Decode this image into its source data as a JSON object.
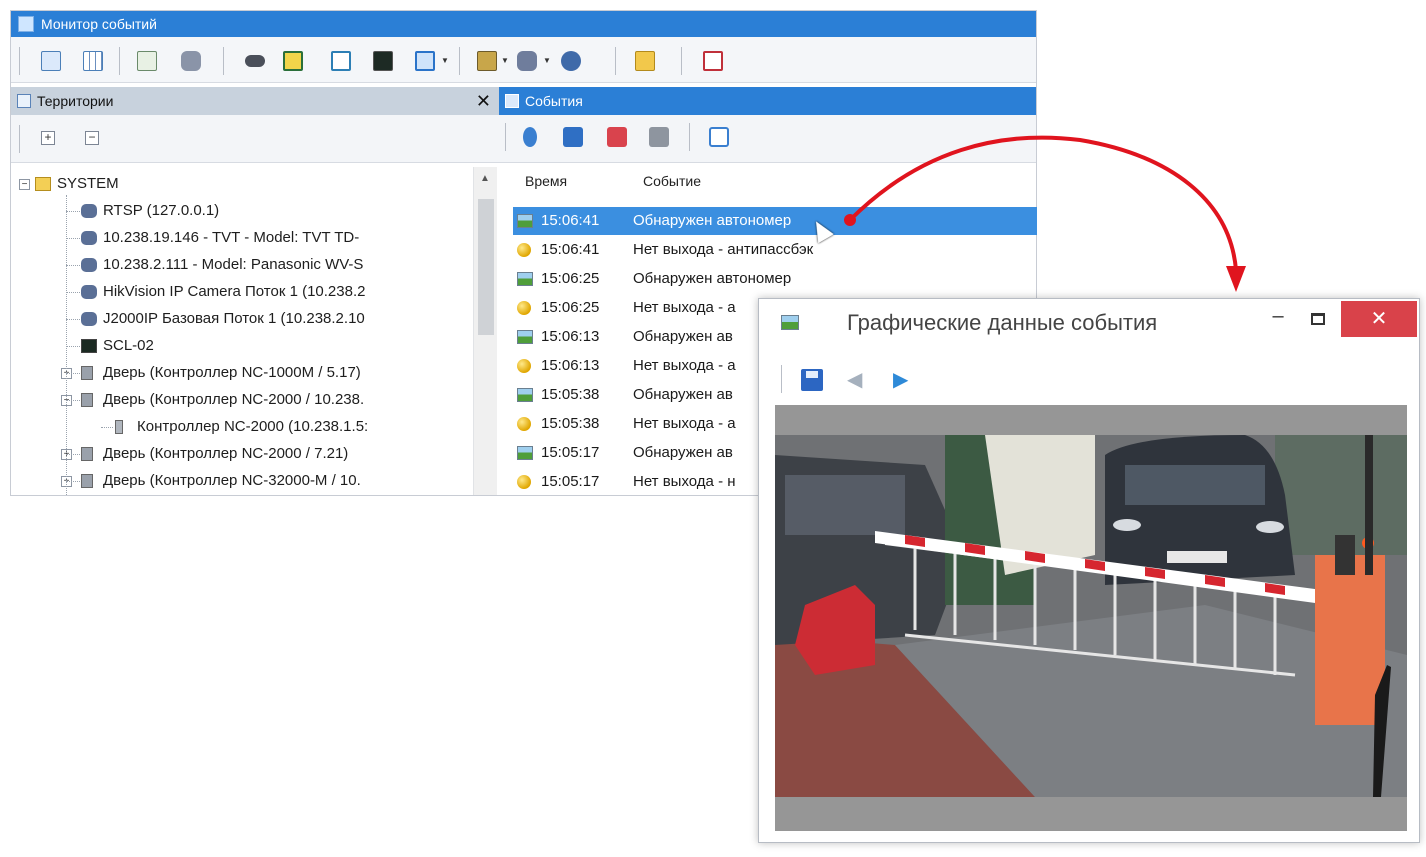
{
  "monitor": {
    "title": "Монитор событий",
    "toolbar_icons": [
      "layout-icon",
      "grid-icon",
      "tree-icon",
      "camera-icon",
      "camera2-icon",
      "display-icon",
      "edit-icon",
      "monitor-icon",
      "window-icon",
      "panel-icon",
      "camera-dropdown-icon",
      "user-icon",
      "folder-icon",
      "report-icon"
    ]
  },
  "territories": {
    "title": "Территории",
    "close_label": "✕",
    "tree": [
      {
        "label": "SYSTEM",
        "icon": "folder-icon",
        "level": 0,
        "expander": "−"
      },
      {
        "label": "RTSP (127.0.0.1)",
        "icon": "camera-icon",
        "level": 1
      },
      {
        "label": "10.238.19.146 - TVT - Model: TVT TD-",
        "icon": "camera-icon",
        "level": 1
      },
      {
        "label": "10.238.2.111 - Model: Panasonic WV-S",
        "icon": "camera-icon",
        "level": 1
      },
      {
        "label": "HikVision IP Camera Поток 1 (10.238.2",
        "icon": "camera-icon",
        "level": 1
      },
      {
        "label": "J2000IP Базовая Поток 1 (10.238.2.10",
        "icon": "camera-icon",
        "level": 1
      },
      {
        "label": "SCL-02",
        "icon": "monitor-icon",
        "level": 1
      },
      {
        "label": "Дверь (Контроллер NC-1000M / 5.17)",
        "icon": "door-icon",
        "level": 1,
        "expander": "+"
      },
      {
        "label": "Дверь (Контроллер NC-2000 / 10.238.",
        "icon": "door-icon",
        "level": 1,
        "expander": "−"
      },
      {
        "label": "Контроллер NC-2000 (10.238.1.5:",
        "icon": "controller-icon",
        "level": 2
      },
      {
        "label": "Дверь (Контроллер NC-2000 / 7.21)",
        "icon": "door-icon",
        "level": 1,
        "expander": "+"
      },
      {
        "label": "Дверь (Контроллер NC-32000-M / 10.",
        "icon": "door-icon",
        "level": 1,
        "expander": "+"
      }
    ]
  },
  "events": {
    "title": "События",
    "col_time": "Время",
    "col_event": "Событие",
    "rows": [
      {
        "time": "15:06:41",
        "event": "Обнаружен автономер",
        "icon": "image-icon",
        "selected": true
      },
      {
        "time": "15:06:41",
        "event": "Нет выхода - антипассбэк",
        "icon": "status-dot-icon",
        "selected": false
      },
      {
        "time": "15:06:25",
        "event": "Обнаружен автономер",
        "icon": "image-icon",
        "selected": false
      },
      {
        "time": "15:06:25",
        "event": "Нет выхода - а",
        "icon": "status-dot-icon",
        "selected": false
      },
      {
        "time": "15:06:13",
        "event": "Обнаружен ав",
        "icon": "image-icon",
        "selected": false
      },
      {
        "time": "15:06:13",
        "event": "Нет выхода - а",
        "icon": "status-dot-icon",
        "selected": false
      },
      {
        "time": "15:05:38",
        "event": "Обнаружен ав",
        "icon": "image-icon",
        "selected": false
      },
      {
        "time": "15:05:38",
        "event": "Нет выхода - а",
        "icon": "status-dot-icon",
        "selected": false
      },
      {
        "time": "15:05:17",
        "event": "Обнаружен ав",
        "icon": "image-icon",
        "selected": false
      },
      {
        "time": "15:05:17",
        "event": "Нет выхода - н",
        "icon": "status-dot-icon",
        "selected": false
      }
    ]
  },
  "popup": {
    "title": "Графические данные события",
    "minimize": "–",
    "close": "✕",
    "toolbar_icons": [
      "save-icon",
      "back-arrow-icon",
      "forward-arrow-icon"
    ],
    "image": "camera-snapshot-barrier-car"
  },
  "colors": {
    "title_blue": "#2b7fd6",
    "selection_blue": "#3b8fe0",
    "close_red": "#d9424a",
    "annotation_arrow": "#e0141e"
  }
}
